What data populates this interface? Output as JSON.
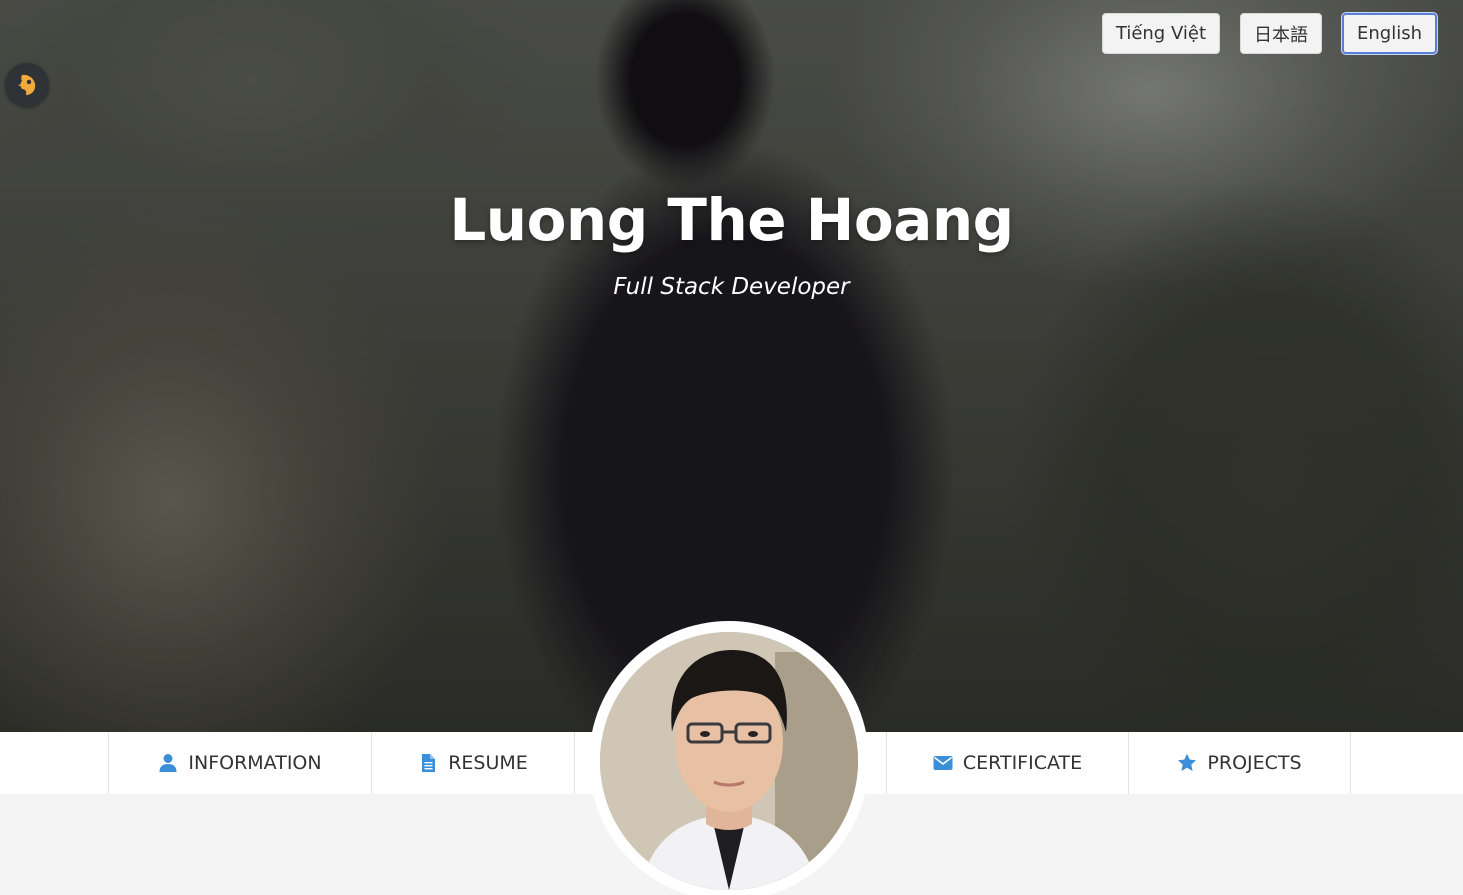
{
  "languages": [
    {
      "label": "Tiếng Việt",
      "active": false
    },
    {
      "label": "日本語",
      "active": false
    },
    {
      "label": "English",
      "active": true
    }
  ],
  "hero": {
    "name": "Luong The Hoang",
    "role": "Full Stack Developer"
  },
  "nav": {
    "information": {
      "label": "INFORMATION",
      "icon": "user-icon"
    },
    "resume": {
      "label": "RESUME",
      "icon": "document-icon"
    },
    "certificate": {
      "label": "CERTIFICATE",
      "icon": "envelope-icon"
    },
    "projects": {
      "label": "PROJECTS",
      "icon": "star-icon"
    }
  },
  "colors": {
    "icon_blue": "#3b8fd8",
    "logo_bg": "#2f3237",
    "logo_accent": "#f2a93b",
    "active_border": "#5b7fd6"
  }
}
